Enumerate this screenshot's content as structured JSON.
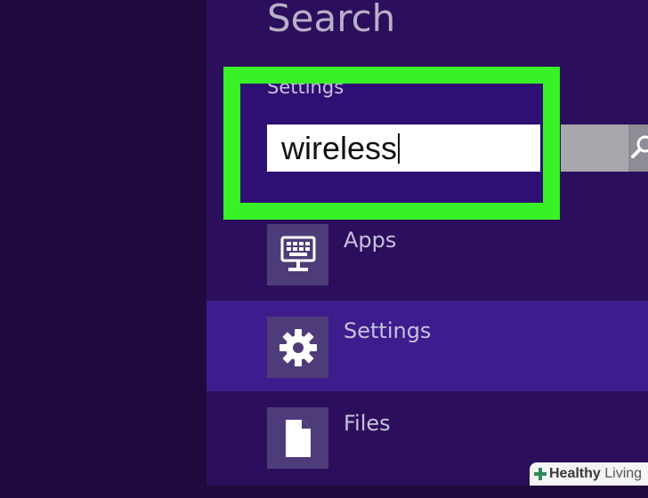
{
  "search_pane": {
    "title": "Search",
    "scope": "Settings",
    "query": "wireless"
  },
  "scopes": [
    {
      "label": "Apps",
      "icon": "keyboard-monitor-icon"
    },
    {
      "label": "Settings",
      "icon": "gear-icon",
      "selected": true
    },
    {
      "label": "Files",
      "icon": "document-icon"
    }
  ],
  "watermark": {
    "brand_bold": "Healthy",
    "brand_light": " Living"
  },
  "colors": {
    "background": "#1e0a3c",
    "pane": "#2b0f5c",
    "selected_row": "#3d1d8d",
    "annotation": "#38f126",
    "tile": "#4d3c79"
  }
}
